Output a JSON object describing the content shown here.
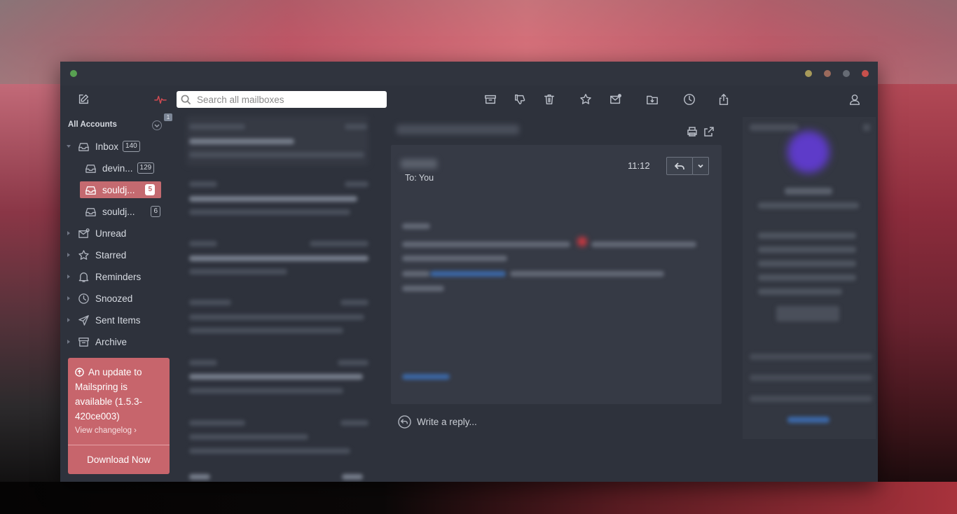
{
  "toolbar": {
    "compose_icon": "compose-icon",
    "activity_badge": "1",
    "search_placeholder": "Search all mailboxes",
    "actions": [
      "archive-icon",
      "thumbs-down-icon",
      "trash-icon",
      "star-icon",
      "mark-unread-icon",
      "move-folder-icon",
      "snooze-icon",
      "share-icon",
      "account-icon"
    ]
  },
  "sidebar": {
    "account_header": "All Accounts",
    "inbox": {
      "label": "Inbox",
      "count": "140"
    },
    "accounts": [
      {
        "label": "devin...",
        "count": "129"
      },
      {
        "label": "souldj...",
        "count": "5"
      },
      {
        "label": "souldj...",
        "count": "6"
      }
    ],
    "folders": [
      {
        "label": "Unread"
      },
      {
        "label": "Starred"
      },
      {
        "label": "Reminders"
      },
      {
        "label": "Snoozed"
      },
      {
        "label": "Sent Items"
      },
      {
        "label": "Archive"
      }
    ],
    "update": {
      "message": "An update to Mailspring is available (1.5.3-420ce003)",
      "changelog": "View changelog ›",
      "download": "Download Now"
    }
  },
  "reader": {
    "to": "To: You",
    "time": "11:12",
    "write_reply": "Write a reply..."
  },
  "colors": {
    "accent": "#c7656c",
    "window_bg": "#2e323c",
    "text": "#d7dbe2"
  }
}
